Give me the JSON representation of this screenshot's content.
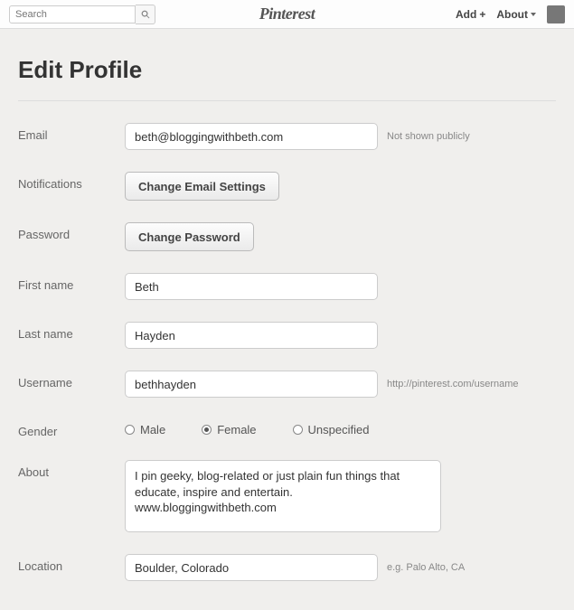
{
  "topbar": {
    "search_placeholder": "Search",
    "logo": "Pinterest",
    "menu_add": "Add",
    "menu_about": "About"
  },
  "page": {
    "title": "Edit Profile"
  },
  "fields": {
    "email": {
      "label": "Email",
      "value": "beth@bloggingwithbeth.com",
      "hint": "Not shown publicly"
    },
    "notifications": {
      "label": "Notifications",
      "button": "Change Email Settings"
    },
    "password": {
      "label": "Password",
      "button": "Change Password"
    },
    "first_name": {
      "label": "First name",
      "value": "Beth"
    },
    "last_name": {
      "label": "Last name",
      "value": "Hayden"
    },
    "username": {
      "label": "Username",
      "value": "bethhayden",
      "hint": "http://pinterest.com/username"
    },
    "gender": {
      "label": "Gender",
      "options": {
        "male": "Male",
        "female": "Female",
        "unspecified": "Unspecified"
      },
      "selected": "female"
    },
    "about": {
      "label": "About",
      "value": "I pin geeky, blog-related or just plain fun things that educate, inspire and entertain.\nwww.bloggingwithbeth.com"
    },
    "location": {
      "label": "Location",
      "value": "Boulder, Colorado",
      "hint": "e.g. Palo Alto, CA"
    }
  }
}
